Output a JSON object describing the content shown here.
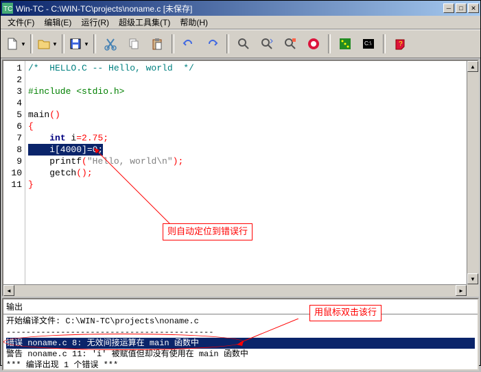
{
  "window": {
    "title": "Win-TC - C:\\WIN-TC\\projects\\noname.c  [未保存]"
  },
  "menu": {
    "file": "文件(F)",
    "edit": "编辑(E)",
    "run": "运行(R)",
    "tools": "超级工具集(T)",
    "help": "帮助(H)"
  },
  "gutter": [
    "1",
    "2",
    "3",
    "4",
    "5",
    "6",
    "7",
    "8",
    "9",
    "10",
    "11"
  ],
  "code": {
    "l1_a": "/*  HELLO.C -- Hello, world  */",
    "l3_a": "#include <stdio.h>",
    "l5_a": "main",
    "l5_b": "()",
    "l6_a": "{",
    "l7_a": "int",
    "l7_b": " i",
    "l7_c": "=",
    "l7_d": "2.75",
    "l7_e": ";",
    "l8_a": "    i[4000]=0;",
    "l9_a": "printf",
    "l9_b": "(",
    "l9_c": "\"Hello, world\\n\"",
    "l9_d": ")",
    "l9_e": ";",
    "l10_a": "getch",
    "l10_b": "()",
    "l10_c": ";",
    "l11_a": "}"
  },
  "annotations": {
    "auto_locate": "则自动定位到错误行",
    "double_click": "用鼠标双击该行"
  },
  "output": {
    "title": "输出",
    "compile_start": "开始编译文件: C:\\WIN-TC\\projects\\noname.c",
    "error_line": "错误 noname.c 8: 无效间接运算在 main 函数中",
    "warning_line": "警告 noname.c 11: 'i' 被赋值但却没有使用在 main 函数中",
    "summary": "***  编译出现 1 个错误  ***"
  }
}
